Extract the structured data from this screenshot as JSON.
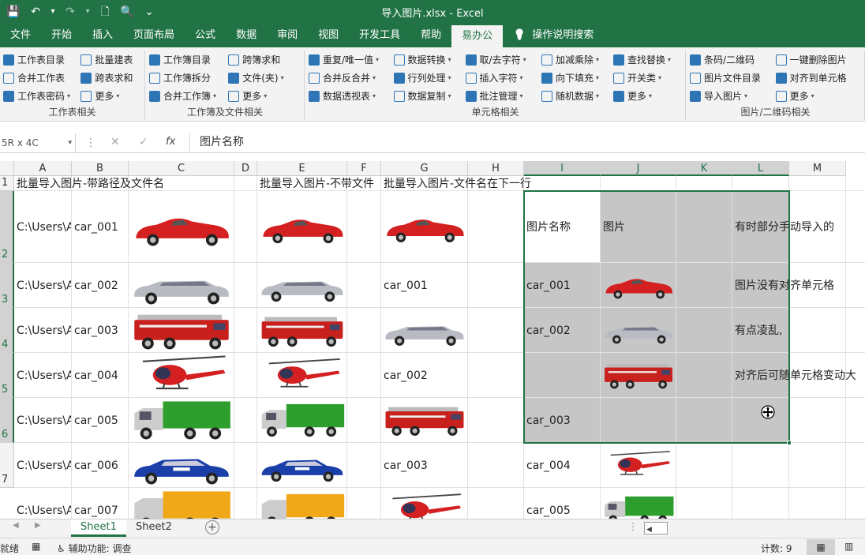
{
  "app": {
    "file_title": "导入图片.xlsx",
    "app_name": "Excel",
    "title_sep": " - "
  },
  "qat": {
    "save": "💾",
    "undo": "↶",
    "undo_caret": "▾",
    "redo": "↷",
    "redo_caret": "▾",
    "new": "🗋",
    "preview": "🔍",
    "customize": "⌄"
  },
  "tabs": [
    "文件",
    "开始",
    "插入",
    "页面布局",
    "公式",
    "数据",
    "审阅",
    "视图",
    "开发工具",
    "帮助",
    "易办公",
    "操作说明搜索"
  ],
  "tabs_active": "易办公",
  "ribbon": {
    "groups": [
      {
        "label": "工作表相关",
        "rows": [
          [
            "工作表目录",
            "批量建表"
          ],
          [
            "合并工作表",
            "跨表求和"
          ],
          [
            "工作表密码",
            "更多"
          ]
        ],
        "carets": [
          [
            false,
            false
          ],
          [
            false,
            false
          ],
          [
            true,
            true
          ]
        ]
      },
      {
        "label": "工作簿及文件相关",
        "rows": [
          [
            "工作簿目录",
            "跨簿求和"
          ],
          [
            "工作簿拆分",
            "文件(夹)"
          ],
          [
            "合并工作簿",
            "更多"
          ]
        ],
        "carets": [
          [
            false,
            false
          ],
          [
            false,
            true
          ],
          [
            true,
            true
          ]
        ]
      },
      {
        "label": "单元格相关",
        "rows": [
          [
            "重复/唯一值",
            "数据转换",
            "取/去字符",
            "加减乘除",
            "查找替换"
          ],
          [
            "合并反合并",
            "行列处理",
            "插入字符",
            "向下填充",
            "开关类"
          ],
          [
            "数据透视表",
            "数据复制",
            "批注管理",
            "随机数据",
            "更多"
          ]
        ]
      },
      {
        "label": "图片/二维码相关",
        "rows": [
          [
            "条码/二维码",
            "一键删除图片"
          ],
          [
            "图片文件目录",
            "对齐到单元格"
          ],
          [
            "导入图片",
            "更多"
          ]
        ]
      }
    ]
  },
  "formula_bar": {
    "name_box": "5R x 4C",
    "name_box_caret": "▾",
    "sep": "⋮",
    "cancel": "✕",
    "enter": "✓",
    "fx": "fx",
    "content": "图片名称"
  },
  "columns": [
    "A",
    "B",
    "C",
    "D",
    "E",
    "F",
    "G",
    "H",
    "I",
    "J",
    "K",
    "L",
    "M"
  ],
  "rows": [
    "1",
    "2",
    "3",
    "4",
    "5",
    "6",
    "7"
  ],
  "cells": {
    "A1": "批量导入图片-带路径及文件名",
    "E1": "批量导入图片-不带文件",
    "G1": "批量导入图片-文件名在下一行",
    "A2": "C:\\Users\\A",
    "B2": "car_001",
    "A3": "C:\\Users\\A",
    "B3": "car_002",
    "G3": "car_001",
    "A4": "C:\\Users\\A",
    "B4": "car_003",
    "A5": "C:\\Users\\A",
    "B5": "car_004",
    "G5": "car_002",
    "A6": "C:\\Users\\A",
    "B6": "car_005",
    "A7": "C:\\Users\\A",
    "B7": "car_006",
    "G7": "car_003",
    "A8": "C:\\Users\\A",
    "B8": "car_007",
    "I2": "图片名称",
    "J2": "图片",
    "I3": "car_001",
    "I4": "car_002",
    "I6": "car_003",
    "I7": "car_004",
    "I8": "car_005",
    "L2": "有时部分手动导入的",
    "L3": "图片没有对齐单元格",
    "L4": "有点凌乱,",
    "L5": "对齐后可随单元格变动大"
  },
  "colors": {
    "excel_green": "#217346",
    "car_red": "#d42020",
    "car_silver": "#b8bcc2",
    "truck_red": "#c8201c",
    "truck_green": "#2e9e2e",
    "truck_yellow": "#f0a818",
    "police_blue": "#1a3fa8"
  },
  "icons": {
    "red_car": "red-convertible-icon",
    "silver_car": "silver-limousine-icon",
    "fire_truck": "fire-truck-icon",
    "helicopter": "helicopter-icon",
    "green_truck": "green-truck-icon",
    "police_car": "police-car-icon",
    "yellow_truck": "yellow-truck-icon",
    "bulb": "lightbulb-icon",
    "move_cursor": "move-cursor-icon"
  },
  "sheets": [
    "Sheet1",
    "Sheet2"
  ],
  "sheets_active": "Sheet1",
  "sheet_nav": {
    "prev": "◀",
    "next": "▶",
    "add": "+"
  },
  "status": {
    "ready": "就绪",
    "macro_icon": "▦",
    "accessibility": "辅助功能: 调查",
    "count": "计数: 9",
    "view_normal": "▦",
    "view_page": "▥"
  }
}
